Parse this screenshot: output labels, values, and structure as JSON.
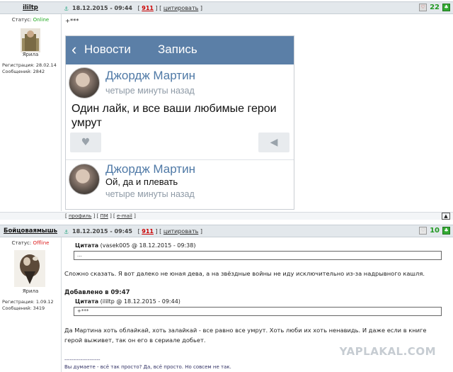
{
  "post1": {
    "author": "ililtp",
    "date": "18.12.2015 - 09:44",
    "num": "911",
    "quote_btn": "цитировать",
    "rating": "22",
    "status_label": "Статус:",
    "status": "Online",
    "rank": "Ярила",
    "reg_label": "Регистрация:",
    "reg": "28.02.14",
    "msgs_label": "Сообщений:",
    "msgs": "2842",
    "text_top": "+***",
    "vk": {
      "back_label": "Новости",
      "title": "Запись",
      "name1": "Джордж Мартин",
      "time1": "четыре минуты назад",
      "text1_line1": "Один лайк, и все ваши любимые герои",
      "text1_line2": "умрут",
      "name2": "Джордж Мартин",
      "text2": "Ой, да и плевать",
      "time2": "четыре минуты назад"
    },
    "links": {
      "profile": "профиль",
      "pm": "ПМ",
      "email": "e-mail"
    }
  },
  "post2": {
    "author": "Бойцоваямышь",
    "date": "18.12.2015 - 09:45",
    "num": "911",
    "quote_btn": "цитировать",
    "rating": "10",
    "status_label": "Статус:",
    "status": "Offline",
    "rank": "Ярила",
    "reg_label": "Регистрация:",
    "reg": "1.09.12",
    "msgs_label": "Сообщений:",
    "msgs": "3419",
    "quote1_label": "Цитата",
    "quote1_src": "(vasek005 @ 18.12.2015 - 09:38)",
    "quote1_text": "...",
    "text1": "Сложно сказать. Я вот далеко не юная дева, а на звёздные войны не иду исключительно из-за надрывного кашля.",
    "added": "Добавлено в 09:47",
    "quote2_label": "Цитата",
    "quote2_src": "(ililtp @ 18.12.2015 - 09:44)",
    "quote2_text": "+***",
    "text2_line1": "Да Мартина хоть облайкай, хоть залайкай - все равно все умрут. Хоть люби их хоть ненавидь. И даже если в книге",
    "text2_line2": "герой выживет, так он его в сериале добьет.",
    "sig_sep": "--------------------",
    "sig": "Вы думаете - всё так просто? Да, всё просто. Но совсем не так."
  },
  "watermark": "YAPLAKAL.COM"
}
